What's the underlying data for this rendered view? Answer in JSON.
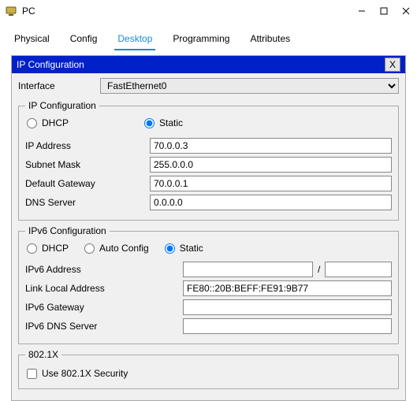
{
  "window": {
    "title": "PC"
  },
  "tabs": {
    "t0": "Physical",
    "t1": "Config",
    "t2": "Desktop",
    "t3": "Programming",
    "t4": "Attributes"
  },
  "panel": {
    "title": "IP Configuration",
    "close": "X"
  },
  "interface": {
    "label": "Interface",
    "value": "FastEthernet0"
  },
  "ipv4": {
    "legend": "IP Configuration",
    "dhcp": "DHCP",
    "static": "Static",
    "ip_label": "IP Address",
    "ip_value": "70.0.0.3",
    "mask_label": "Subnet Mask",
    "mask_value": "255.0.0.0",
    "gw_label": "Default Gateway",
    "gw_value": "70.0.0.1",
    "dns_label": "DNS Server",
    "dns_value": "0.0.0.0"
  },
  "ipv6": {
    "legend": "IPv6 Configuration",
    "dhcp": "DHCP",
    "auto": "Auto Config",
    "static": "Static",
    "addr_label": "IPv6 Address",
    "addr_value": "",
    "prefix_value": "",
    "ll_label": "Link Local Address",
    "ll_value": "FE80::20B:BEFF:FE91:9B77",
    "gw_label": "IPv6 Gateway",
    "gw_value": "",
    "dns_label": "IPv6 DNS Server",
    "dns_value": ""
  },
  "dot1x": {
    "legend": "802.1X",
    "chk_label": "Use 802.1X Security"
  }
}
